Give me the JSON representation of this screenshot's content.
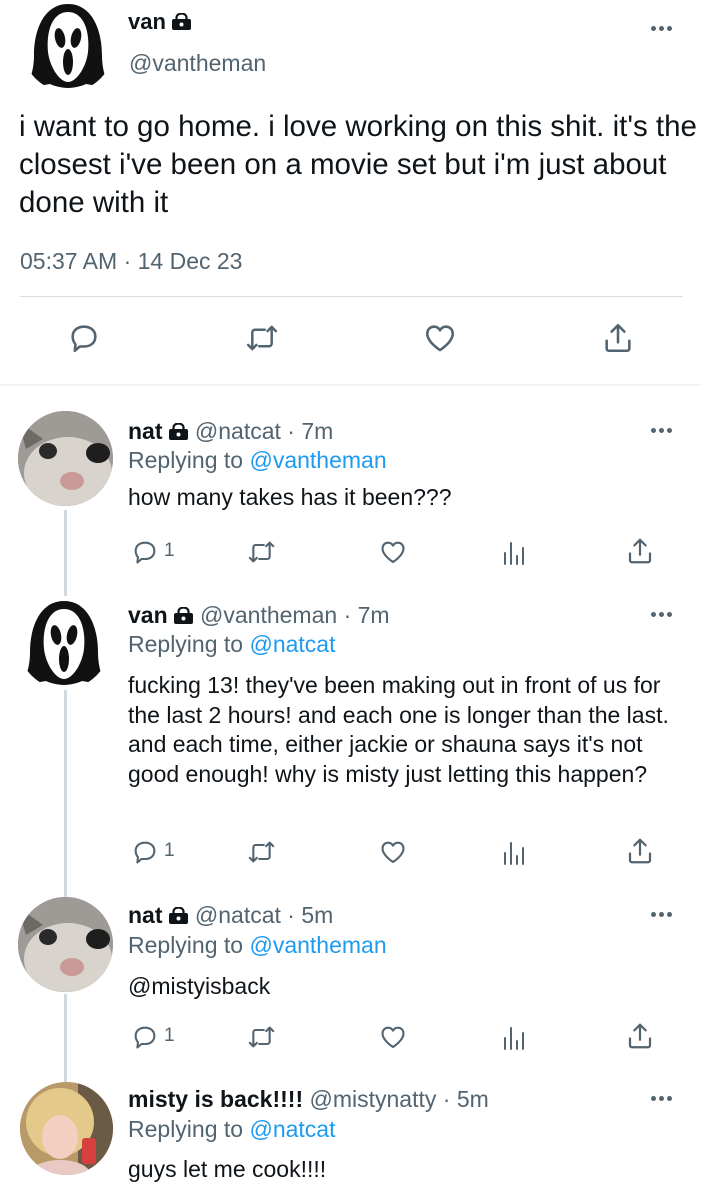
{
  "main_tweet": {
    "name": "van",
    "handle": "@vantheman",
    "text": "i want to go home. i love working on this shit. it's the closest i've been on a movie set but i'm just about done with it",
    "timestamp": "05:37 AM · 14 Dec 23"
  },
  "replies": [
    {
      "name": "nat",
      "handle": "@natcat",
      "time": "· 7m",
      "replying_label": "Replying to",
      "replying_to": "@vantheman",
      "text": "how many takes has it been???",
      "reply_count": "1"
    },
    {
      "name": "van",
      "handle": "@vantheman",
      "time": "· 7m",
      "replying_label": "Replying to",
      "replying_to": "@natcat",
      "text": "fucking 13! they've been making out in front of us for the last 2 hours! and each one is longer than the last. and each time, either jackie or shauna says it's not good enough! why is misty just letting this happen?",
      "reply_count": "1"
    },
    {
      "name": "nat",
      "handle": "@natcat",
      "time": "· 5m",
      "replying_label": "Replying to",
      "replying_to": "@vantheman",
      "text": "@mistyisback",
      "reply_count": "1"
    },
    {
      "name": "misty is back!!!!",
      "handle": "@mistynatty",
      "time": "· 5m",
      "replying_label": "Replying to",
      "replying_to": "@natcat",
      "text": "guys let me cook!!!!"
    }
  ],
  "colors": {
    "link": "#1d9bf0",
    "secondary": "#536471",
    "text": "#0f1419"
  },
  "icons": [
    "lock-icon",
    "more-icon",
    "reply-icon",
    "retweet-icon",
    "like-icon",
    "share-icon",
    "analytics-icon"
  ]
}
